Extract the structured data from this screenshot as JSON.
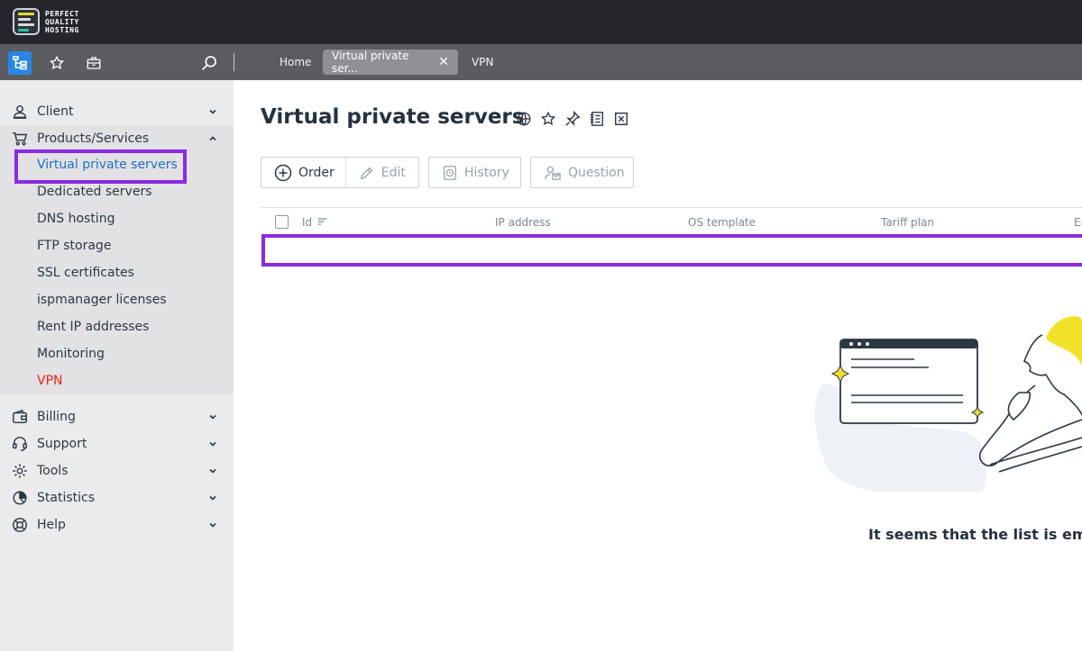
{
  "brand": {
    "logo_mark": "PQ",
    "name_line1": "PERFECT",
    "name_line2": "QUALITY",
    "name_line3": "HOSTING"
  },
  "toolbar": {
    "tabs": [
      {
        "label": "Home"
      },
      {
        "label": "Virtual private ser...",
        "close": "✕"
      },
      {
        "label": "VPN"
      }
    ]
  },
  "sidebar": {
    "sections": [
      {
        "label": "Client",
        "icon": "user-icon"
      },
      {
        "label": "Products/Services",
        "icon": "cart-icon"
      },
      {
        "label": "Billing",
        "icon": "wallet-icon"
      },
      {
        "label": "Support",
        "icon": "headset-icon"
      },
      {
        "label": "Tools",
        "icon": "gear-icon"
      },
      {
        "label": "Statistics",
        "icon": "pie-chart-icon"
      },
      {
        "label": "Help",
        "icon": "lifebuoy-icon"
      }
    ],
    "sub_items": [
      {
        "label": "Virtual private servers"
      },
      {
        "label": "Dedicated servers"
      },
      {
        "label": "DNS hosting"
      },
      {
        "label": "FTP storage"
      },
      {
        "label": "SSL certificates"
      },
      {
        "label": "ispmanager licenses"
      },
      {
        "label": "Rent IP addresses"
      },
      {
        "label": "Monitoring"
      },
      {
        "label": "VPN"
      }
    ]
  },
  "main": {
    "title": "Virtual private servers",
    "actions": {
      "order": "Order",
      "edit": "Edit",
      "history": "History",
      "question": "Question"
    },
    "table": {
      "columns": [
        "Id",
        "IP address",
        "OS template",
        "Tariff plan",
        "Er"
      ]
    },
    "empty_message": "It seems that the list is empt"
  },
  "colors": {
    "accent_blue": "#2a86e4",
    "highlight_purple": "#8a2be2",
    "vpn_red": "#e8231b",
    "illustration_yellow": "#f2e12a"
  }
}
